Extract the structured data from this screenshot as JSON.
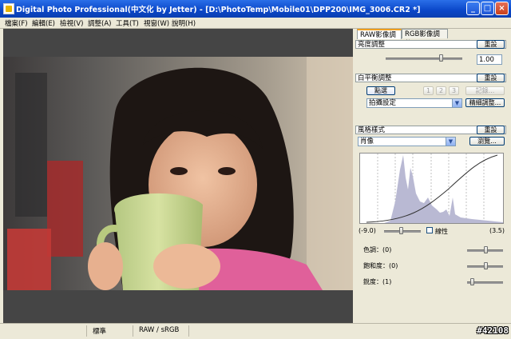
{
  "window": {
    "title": "Digital Photo Professional(中文化 by Jetter) - [D:\\PhotoTemp\\Mobile01\\DPP200\\IMG_3006.CR2 *]",
    "icon": "dpp-app-icon",
    "minimize_icon": "minimize-icon",
    "maximize_icon": "maximize-icon",
    "close_icon": "close-icon"
  },
  "menubar": {
    "items": [
      "檔案(F)",
      "編輯(E)",
      "檢視(V)",
      "調整(A)",
      "工具(T)",
      "視窗(W)",
      "說明(H)"
    ]
  },
  "panel": {
    "tabs": [
      "RAW影像調整",
      "RGB影像調整"
    ],
    "active_tab": 0,
    "brightness": {
      "title": "亮度調整",
      "reset_label": "重設",
      "value": "1.00",
      "slider_position": 0.72
    },
    "white_balance": {
      "title": "白平衡調整",
      "reset_label": "重設",
      "click_label": "點選",
      "preset_buttons": [
        "1",
        "2",
        "3"
      ],
      "register_label": "記錄...",
      "select_value": "拍攝設定",
      "fine_tune_label": "精細調整..."
    },
    "picture_style": {
      "title": "風格樣式",
      "reset_label": "重設",
      "select_value": "肖像",
      "browse_label": "瀏覽...",
      "range_min": "(-9.0)",
      "range_max": "(3.5)",
      "range_slider_position": 0.45,
      "linear_label": "線性",
      "linear_checked": false,
      "tone_label": "色調：(0)",
      "tone_position": 0.5,
      "saturation_label": "飽和度：(0)",
      "saturation_position": 0.5,
      "sharpness_label": "銳度：(1)",
      "sharpness_position": 0.14
    },
    "histogram_color": "#b9b9d3",
    "curve_color": "#333333"
  },
  "statusbar": {
    "cells": [
      "",
      "標準",
      "RAW / sRGB"
    ],
    "watermark": "#42108"
  }
}
